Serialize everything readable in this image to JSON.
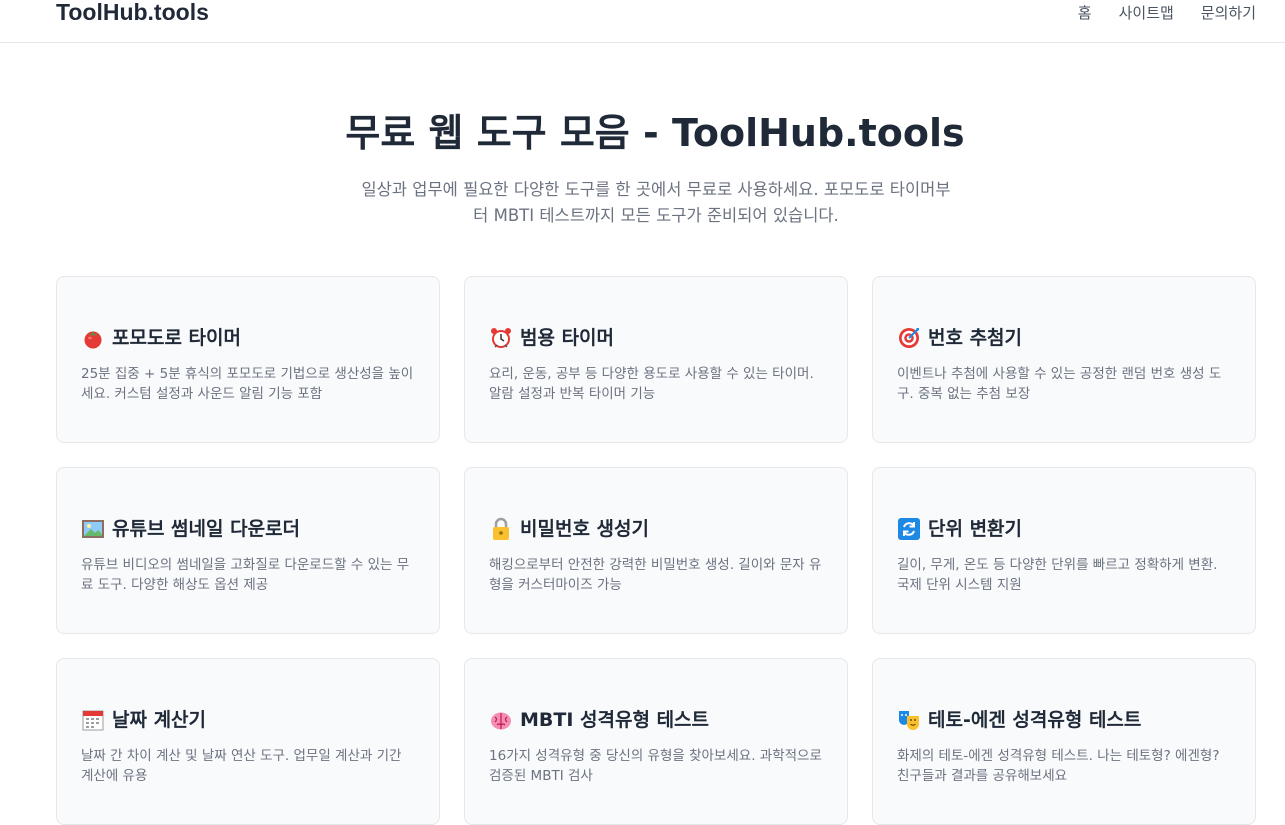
{
  "header": {
    "logo": "ToolHub.tools",
    "nav": [
      {
        "label": "홈"
      },
      {
        "label": "사이트맵"
      },
      {
        "label": "문의하기"
      }
    ]
  },
  "hero": {
    "title": "무료 웹 도구 모음 - ToolHub.tools",
    "subtitle": "일상과 업무에 필요한 다양한 도구를 한 곳에서 무료로 사용하세요. 포모도로 타이머부터 MBTI 테스트까지 모든 도구가 준비되어 있습니다."
  },
  "tools": [
    {
      "icon": "tomato-icon",
      "title": "포모도로 타이머",
      "desc": "25분 집중 + 5분 휴식의 포모도로 기법으로 생산성을 높이세요. 커스텀 설정과 사운드 알림 기능 포함"
    },
    {
      "icon": "alarm-clock-icon",
      "title": "범용 타이머",
      "desc": "요리, 운동, 공부 등 다양한 용도로 사용할 수 있는 타이머. 알람 설정과 반복 타이머 기능"
    },
    {
      "icon": "target-icon",
      "title": "번호 추첨기",
      "desc": "이벤트나 추첨에 사용할 수 있는 공정한 랜덤 번호 생성 도구. 중복 없는 추첨 보장"
    },
    {
      "icon": "picture-icon",
      "title": "유튜브 썸네일 다운로더",
      "desc": "유튜브 비디오의 썸네일을 고화질로 다운로드할 수 있는 무료 도구. 다양한 해상도 옵션 제공"
    },
    {
      "icon": "lock-icon",
      "title": "비밀번호 생성기",
      "desc": "해킹으로부터 안전한 강력한 비밀번호 생성. 길이와 문자 유형을 커스터마이즈 가능"
    },
    {
      "icon": "refresh-icon",
      "title": "단위 변환기",
      "desc": "길이, 무게, 온도 등 다양한 단위를 빠르고 정확하게 변환. 국제 단위 시스템 지원"
    },
    {
      "icon": "calendar-icon",
      "title": "날짜 계산기",
      "desc": "날짜 간 차이 계산 및 날짜 연산 도구. 업무일 계산과 기간 계산에 유용"
    },
    {
      "icon": "brain-icon",
      "title": "MBTI 성격유형 테스트",
      "desc": "16가지 성격유형 중 당신의 유형을 찾아보세요. 과학적으로 검증된 MBTI 검사"
    },
    {
      "icon": "theater-masks-icon",
      "title": "테토-에겐 성격유형 테스트",
      "desc": "화제의 테토-에겐 성격유형 테스트. 나는 테토형? 에겐형? 친구들과 결과를 공유해보세요"
    }
  ]
}
